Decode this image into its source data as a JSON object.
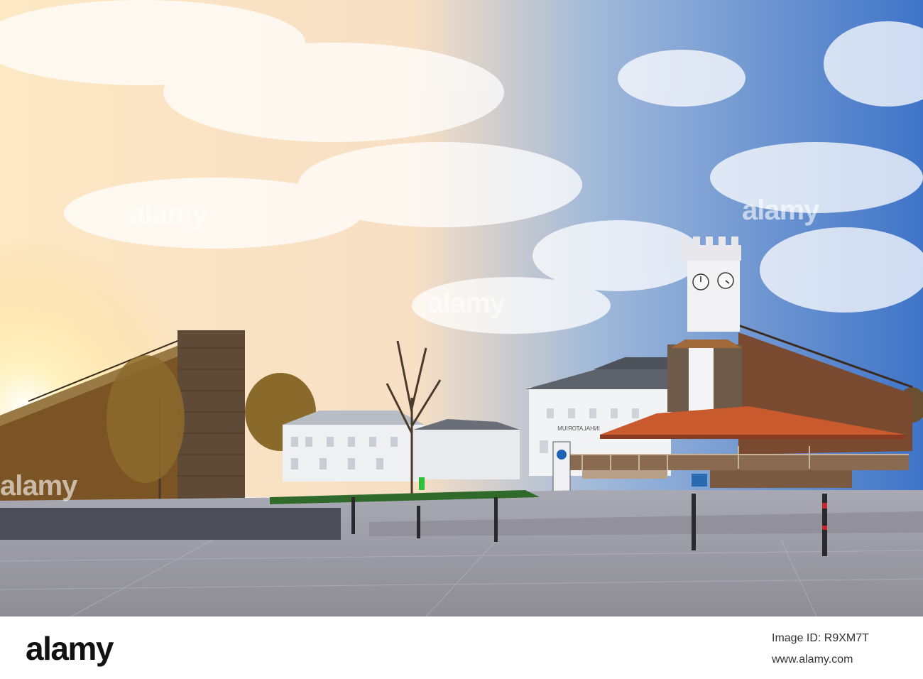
{
  "photo": {
    "watermarks": [
      "alamy",
      "alamy",
      "alamy",
      "alamy"
    ],
    "sign_text": "INHALATORIUM"
  },
  "footer": {
    "logo": "alamy",
    "image_id_label": "Image ID: R9XM7T",
    "site": "www.alamy.com"
  }
}
